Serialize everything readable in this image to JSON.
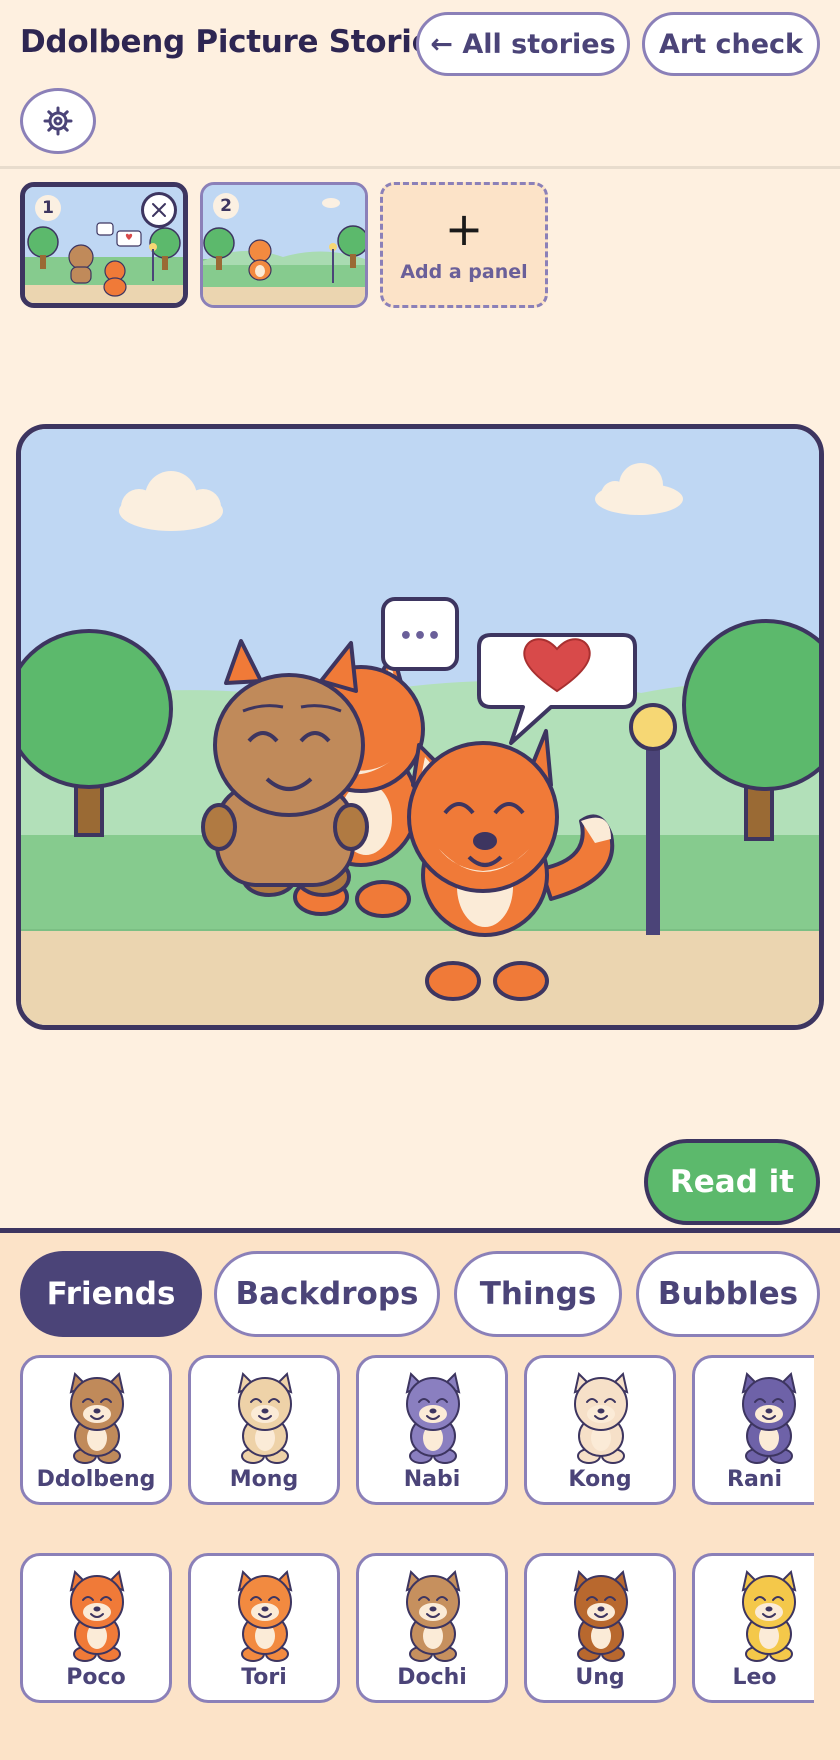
{
  "header": {
    "title": "Ddolbeng Picture Stories",
    "all_stories_label": "← All stories",
    "art_check_label": "Art check",
    "settings_icon": "gear-icon"
  },
  "panels": {
    "items": [
      {
        "number": "1",
        "selected": true
      },
      {
        "number": "2",
        "selected": false
      }
    ],
    "add_plus": "+",
    "add_label": "Add a panel"
  },
  "scene": {
    "thought_bubble": "•••",
    "speech_bubble_icon": "heart-icon"
  },
  "read_button": "Read it",
  "drawer": {
    "tabs": [
      "Friends",
      "Backdrops",
      "Things",
      "Bubbles"
    ],
    "active_tab": "Friends",
    "characters": [
      {
        "name": "Ddolbeng",
        "color": "#C08A5A"
      },
      {
        "name": "Mong",
        "color": "#EED2A8"
      },
      {
        "name": "Nabi",
        "color": "#8A7FC0"
      },
      {
        "name": "Kong",
        "color": "#F6E0C8"
      },
      {
        "name": "Rani",
        "color": "#6E62A8"
      },
      {
        "name": "Poco",
        "color": "#F07A38"
      },
      {
        "name": "Tori",
        "color": "#F28A40"
      },
      {
        "name": "Dochi",
        "color": "#C6905E"
      },
      {
        "name": "Ung",
        "color": "#B8682E"
      },
      {
        "name": "Leo",
        "color": "#F4C84A"
      }
    ]
  },
  "colors": {
    "background": "#FEF0E0",
    "accent": "#4B4478",
    "outline": "#3D3560",
    "read_green": "#5CB96C",
    "sky": "#BFD7F3",
    "grass": "#86CB8E",
    "ground": "#EBD5B0"
  }
}
